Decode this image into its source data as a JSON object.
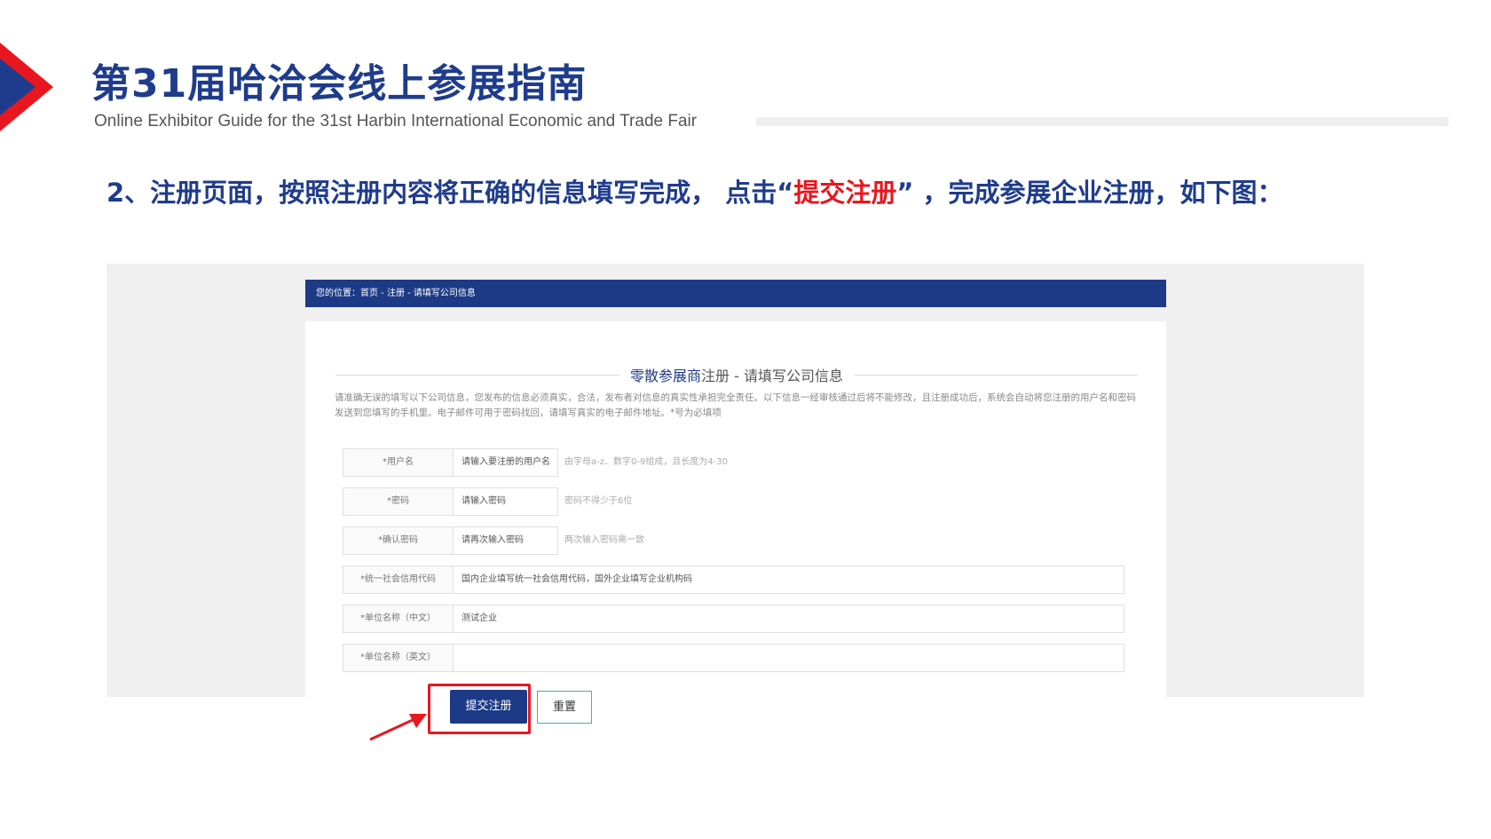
{
  "slide": {
    "title": "第31届哈洽会线上参展指南",
    "subtitle": "Online Exhibitor Guide for the 31st Harbin International Economic and Trade Fair",
    "instruction_prefix": "2、注册页面，按照注册内容将正确的信息填写完成， 点击“",
    "instruction_highlight": "提交注册",
    "instruction_suffix": "” ，完成参展企业注册，如下图：",
    "colors": {
      "brand_blue": "#1f3c8c",
      "accent_red": "#e8171f"
    }
  },
  "screenshot": {
    "breadcrumb": "您的位置：首页 - 注册 - 请填写公司信息",
    "heading_part1": "零散参展商",
    "heading_part2": "注册 - 请填写公司信息",
    "notice": "请准确无误的填写以下公司信息，您发布的信息必须真实，合法，发布者对信息的真实性承担完全责任。以下信息一经审核通过后将不能修改，且注册成功后，系统会自动将您注册的用户名和密码发送到您填写的手机里。电子邮件可用于密码找回，请填写真实的电子邮件地址。*号为必填项",
    "fields": [
      {
        "label": "*用户名",
        "value": "请输入要注册的用户名",
        "hint": "由字母a-z、数字0-9组成，且长度为4-30"
      },
      {
        "label": "*密码",
        "value": "请输入密码",
        "hint": "密码不得少于6位"
      },
      {
        "label": "*确认密码",
        "value": "请再次输入密码",
        "hint": "两次输入密码需一致"
      },
      {
        "label": "*统一社会信用代码",
        "value": "国内企业填写统一社会信用代码，国外企业填写企业机构码",
        "hint": ""
      },
      {
        "label": "*单位名称（中文）",
        "value": "测试企业",
        "hint": ""
      },
      {
        "label": "*单位名称（英文）",
        "value": "",
        "hint": ""
      }
    ],
    "submit_label": "提交注册",
    "reset_label": "重置"
  }
}
